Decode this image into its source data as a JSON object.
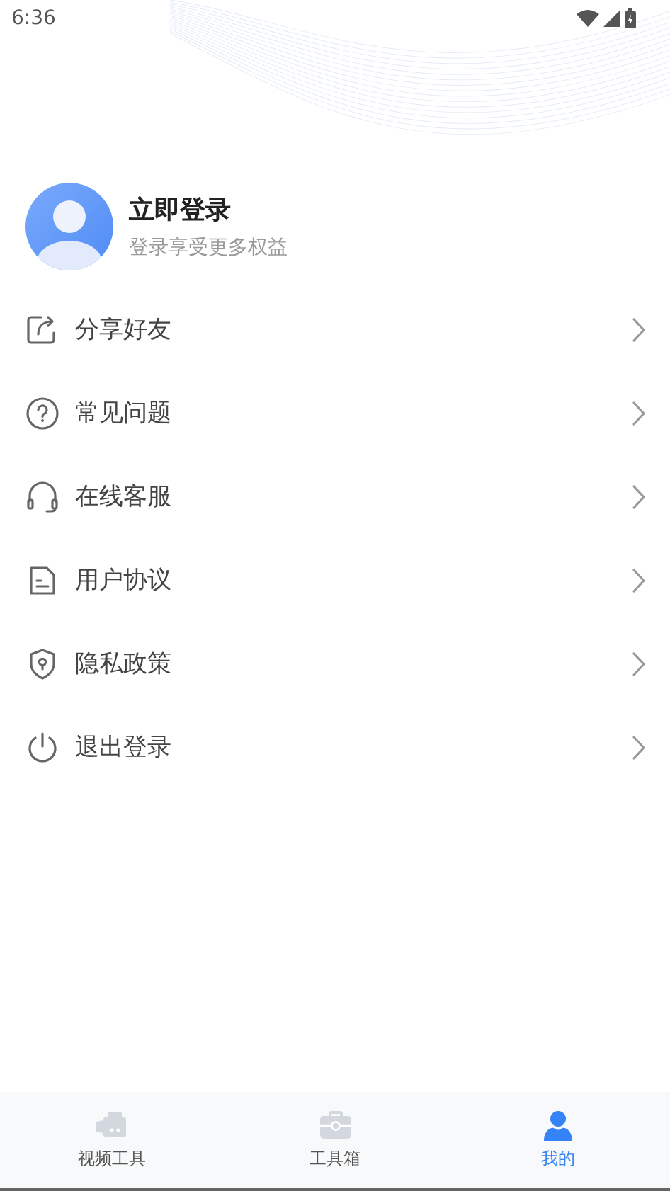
{
  "status_bar": {
    "time": "6:36"
  },
  "profile": {
    "title": "立即登录",
    "subtitle": "登录享受更多权益"
  },
  "menu": [
    {
      "kind": "share",
      "label": "分享好友"
    },
    {
      "kind": "help",
      "label": "常见问题"
    },
    {
      "kind": "headset",
      "label": "在线客服"
    },
    {
      "kind": "document",
      "label": "用户协议"
    },
    {
      "kind": "shield",
      "label": "隐私政策"
    },
    {
      "kind": "power",
      "label": "退出登录"
    }
  ],
  "tabs": [
    {
      "kind": "camera",
      "label": "视频工具",
      "selected": false
    },
    {
      "kind": "toolbox",
      "label": "工具箱",
      "selected": false
    },
    {
      "kind": "person",
      "label": "我的",
      "selected": true
    }
  ]
}
